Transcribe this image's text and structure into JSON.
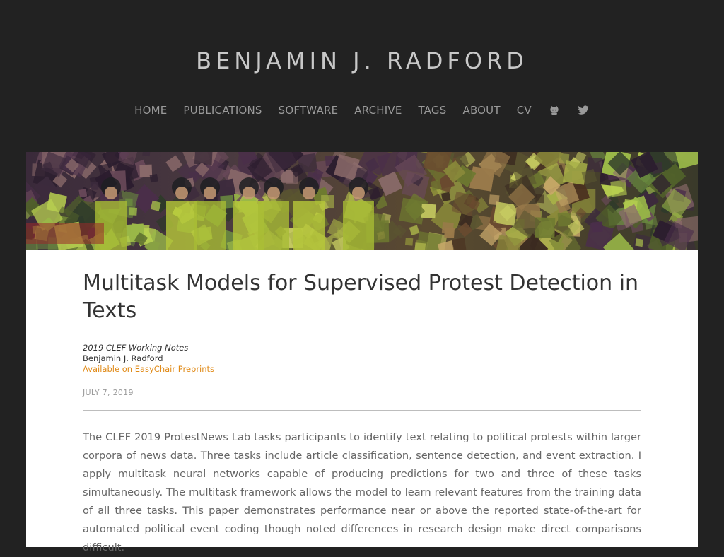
{
  "site": {
    "title": "BENJAMIN J. RADFORD"
  },
  "nav": {
    "items": [
      {
        "label": "HOME"
      },
      {
        "label": "PUBLICATIONS"
      },
      {
        "label": "SOFTWARE"
      },
      {
        "label": "ARCHIVE"
      },
      {
        "label": "TAGS"
      },
      {
        "label": "ABOUT"
      },
      {
        "label": "CV"
      }
    ],
    "icons": [
      {
        "name": "github-icon"
      },
      {
        "name": "twitter-icon"
      }
    ]
  },
  "colors": {
    "background": "#222222",
    "title_text": "#c8c8c8",
    "nav_text": "#9a9a9a",
    "card_background": "#ffffff",
    "link": "#e08a17"
  },
  "post": {
    "title": "Multitask Models for Supervised Protest Detection in Texts",
    "venue": "2019 CLEF Working Notes",
    "author": "Benjamin J. Radford",
    "link_text": "Available on EasyChair Preprints",
    "date": "JULY 7, 2019",
    "abstract": "The CLEF 2019 ProtestNews Lab tasks participants to identify text relating to political protests within larger corpora of news data. Three tasks include article classification, sentence detection, and event extraction. I apply multitask neural networks capable of producing predictions for two and three of these tasks simultaneously. The multitask framework allows the model to learn relevant features from the training data of all three tasks. This paper demonstrates performance near or above the reported state-of-the-art for automated political event coding though noted differences in research design make direct comparisons difficult."
  }
}
